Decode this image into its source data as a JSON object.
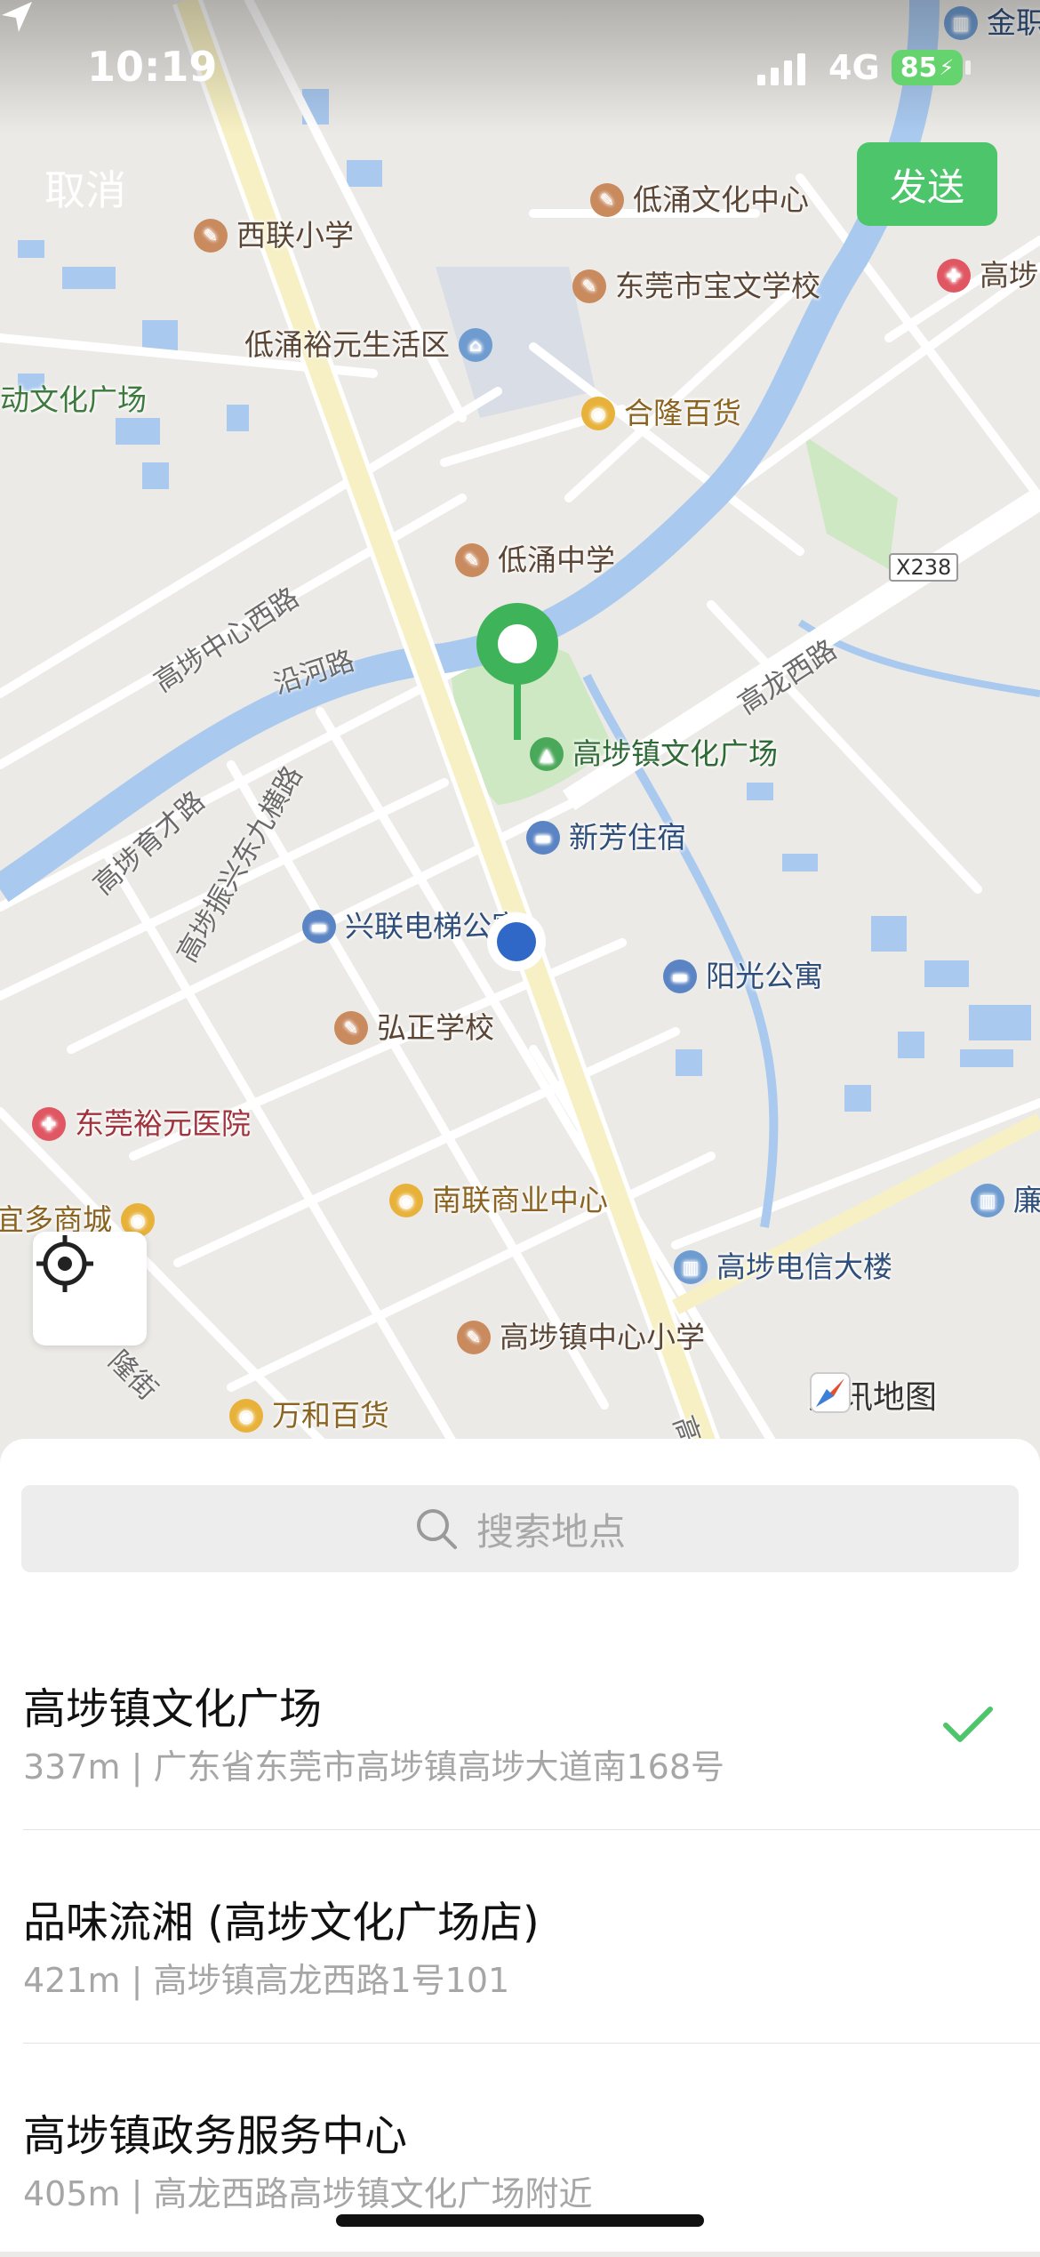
{
  "status": {
    "time": "10:19",
    "network": "4G",
    "battery": "85"
  },
  "header": {
    "cancel_label": "取消",
    "send_label": "发送"
  },
  "map": {
    "pois": [
      {
        "id": "dichong_culture",
        "label": "低涌文化中心",
        "kind": "edu"
      },
      {
        "id": "xilian_school",
        "label": "西联小学",
        "kind": "edu"
      },
      {
        "id": "baowen_school",
        "label": "东莞市宝文学校",
        "kind": "edu"
      },
      {
        "id": "gaobu_hosp",
        "label": "高埗",
        "kind": "hosp"
      },
      {
        "id": "yuyuan",
        "label": "低涌裕元生活区",
        "kind": "home"
      },
      {
        "id": "culture_left",
        "label": "动文化广场",
        "kind": "none"
      },
      {
        "id": "helong",
        "label": "合隆百货",
        "kind": "shop"
      },
      {
        "id": "dichong_middle",
        "label": "低涌中学",
        "kind": "edu"
      },
      {
        "id": "plaza",
        "label": "高埗镇文化广场",
        "kind": "park"
      },
      {
        "id": "xinfang",
        "label": "新芳住宿",
        "kind": "hotel"
      },
      {
        "id": "xinglian",
        "label": "兴联电梯公寓",
        "kind": "hotel"
      },
      {
        "id": "yangguang",
        "label": "阳光公寓",
        "kind": "hotel"
      },
      {
        "id": "hongzheng",
        "label": "弘正学校",
        "kind": "edu"
      },
      {
        "id": "yuyuan_hosp",
        "label": "东莞裕元医院",
        "kind": "hosp"
      },
      {
        "id": "duoshang",
        "label": "宜多商城",
        "kind": "shop"
      },
      {
        "id": "nanlian",
        "label": "南联商业中心",
        "kind": "shop"
      },
      {
        "id": "telecom",
        "label": "高埗电信大楼",
        "kind": "bldg"
      },
      {
        "id": "lian",
        "label": "廉",
        "kind": "bldg"
      },
      {
        "id": "center_school",
        "label": "高埗镇中心小学",
        "kind": "edu"
      },
      {
        "id": "wanhe",
        "label": "万和百货",
        "kind": "shop"
      },
      {
        "id": "jinzhi",
        "label": "金职",
        "kind": "bldg"
      }
    ],
    "roads": {
      "zhongxin_west": "高埗中心西路",
      "yanhe": "沿河路",
      "gaolong_west": "高龙西路",
      "yucai": "高埗育才路",
      "zhenxing": "高埗振兴东九横路",
      "long_street": "隆街",
      "gaobu_bottom": "高埗",
      "x238": "X238"
    },
    "attribution": "腾讯地图"
  },
  "search": {
    "placeholder": "搜索地点"
  },
  "results": [
    {
      "name": "高埗镇文化广场",
      "address": "337m | 广东省东莞市高埗镇高埗大道南168号",
      "selected": true
    },
    {
      "name": "品味流湘 (高埗文化广场店)",
      "address": "421m | 高埗镇高龙西路1号101",
      "selected": false
    },
    {
      "name": "高埗镇政务服务中心",
      "address": "405m | 高龙西路高埗镇文化广场附近",
      "selected": false
    }
  ],
  "colors": {
    "accent": "#4cc56b",
    "river": "#a9c9ef",
    "main_road": "#f7f0c4",
    "park": "#cde8c2",
    "user_dot": "#2f68c7"
  }
}
